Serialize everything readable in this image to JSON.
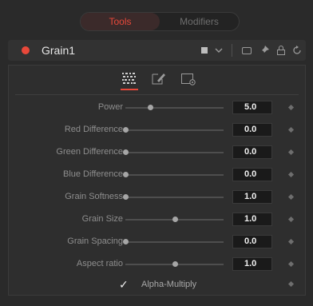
{
  "tabs": {
    "tools": "Tools",
    "modifiers": "Modifiers"
  },
  "tool": {
    "name": "Grain1",
    "active_color": "#e8483a"
  },
  "header_icons": [
    "color-swatch-icon",
    "chevron-down-icon",
    "window-icon",
    "pin-icon",
    "lock-icon",
    "reset-icon"
  ],
  "mode_icons": [
    "grain-pattern-icon",
    "paint-icon",
    "settings-icon"
  ],
  "params": [
    {
      "label": "Power",
      "value": "5.0",
      "level": 0.25
    },
    {
      "label": "Red Difference",
      "value": "0.0",
      "level": 0.0
    },
    {
      "label": "Green Difference",
      "value": "0.0",
      "level": 0.0
    },
    {
      "label": "Blue Difference",
      "value": "0.0",
      "level": 0.0
    },
    {
      "label": "Grain Softness",
      "value": "1.0",
      "level": 0.0
    },
    {
      "label": "Grain Size",
      "value": "1.0",
      "level": 0.5
    },
    {
      "label": "Grain Spacing",
      "value": "0.0",
      "level": 0.0
    },
    {
      "label": "Aspect ratio",
      "value": "1.0",
      "level": 0.5
    }
  ],
  "alpha_multiply": {
    "label": "Alpha-Multiply",
    "checked": true
  }
}
